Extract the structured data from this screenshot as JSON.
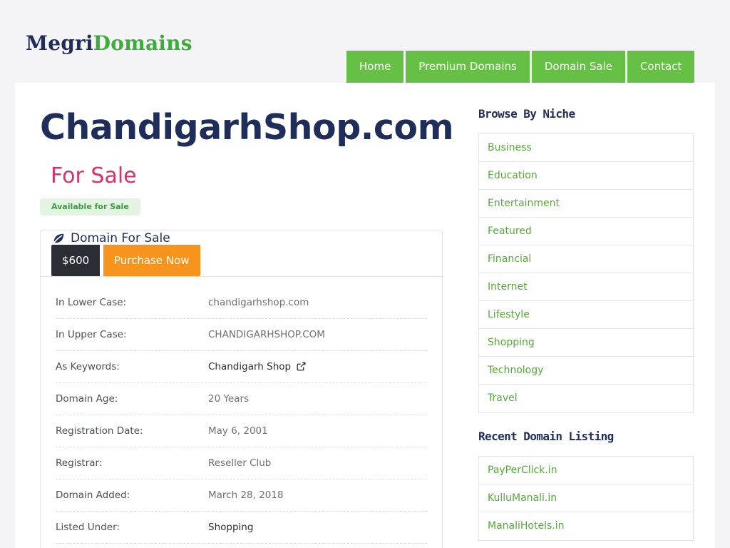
{
  "brand": {
    "part1": "Megri",
    "part2": "Domains"
  },
  "nav": [
    "Home",
    "Premium Domains",
    "Domain Sale",
    "Contact"
  ],
  "domain": {
    "name": "ChandigarhShop.com",
    "for_sale": "For Sale",
    "badge": "Available for Sale"
  },
  "panel": {
    "title": "Domain For Sale",
    "price": "$600",
    "purchase": "Purchase Now",
    "rows": [
      {
        "label": "In Lower Case:",
        "value": "chandigarhshop.com"
      },
      {
        "label": "In Upper Case:",
        "value": "CHANDIGARHSHOP.COM"
      },
      {
        "label": "As Keywords:",
        "value": "Chandigarh Shop"
      },
      {
        "label": "Domain Age:",
        "value": "20 Years"
      },
      {
        "label": "Registration Date:",
        "value": "May 6, 2001"
      },
      {
        "label": "Registrar:",
        "value": "Reseller Club"
      },
      {
        "label": "Domain Added:",
        "value": "March 28, 2018"
      },
      {
        "label": "Listed Under:",
        "value": "Shopping"
      }
    ]
  },
  "sidebar": {
    "niche_title": "Browse By Niche",
    "niches": [
      "Business",
      "Education",
      "Entertainment",
      "Featured",
      "Financial",
      "Internet",
      "Lifestyle",
      "Shopping",
      "Technology",
      "Travel"
    ],
    "recent_title": "Recent Domain Listing",
    "recent": [
      "PayPerClick.in",
      "KulluManali.in",
      "ManaliHotels.in"
    ]
  },
  "colors": {
    "brand_navy": "#1f2d5a",
    "brand_green": "#66c045",
    "accent_pink": "#d4336b",
    "orange": "#f7941d"
  }
}
